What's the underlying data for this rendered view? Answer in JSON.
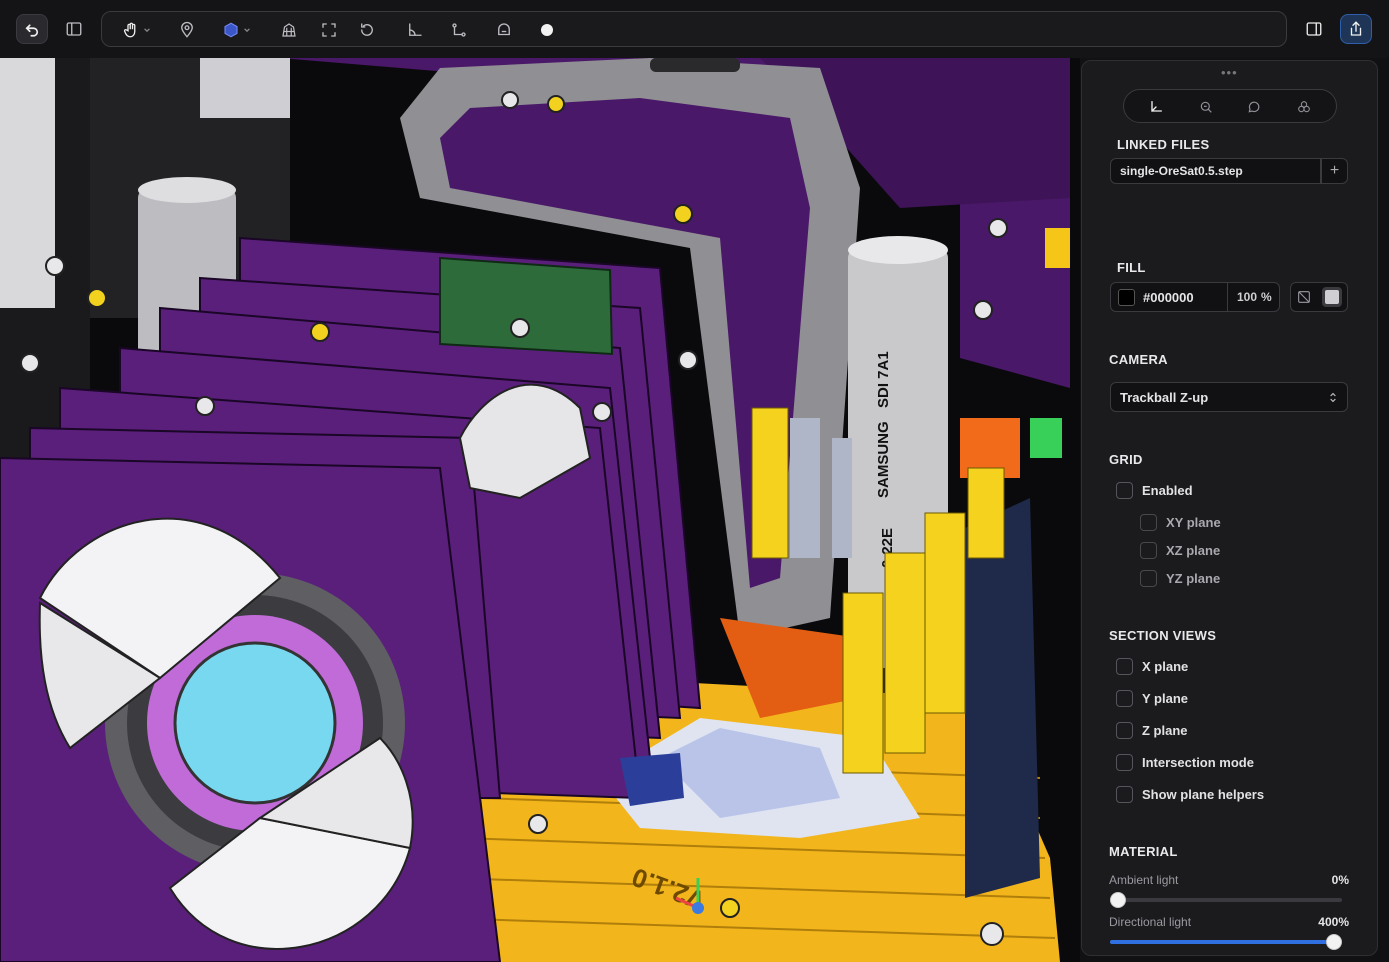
{
  "panel": {
    "linked_files": {
      "title": "LINKED FILES",
      "file": "single-OreSat0.5.step",
      "add_label": "+"
    },
    "fill": {
      "title": "FILL",
      "color_hex": "#000000",
      "opacity": "100",
      "opacity_unit": "%"
    },
    "camera": {
      "title": "CAMERA",
      "mode": "Trackball Z-up"
    },
    "grid": {
      "title": "GRID",
      "enabled_label": "Enabled",
      "planes": [
        "XY plane",
        "XZ plane",
        "YZ plane"
      ]
    },
    "section_views": {
      "title": "SECTION VIEWS",
      "items": [
        "X plane",
        "Y plane",
        "Z plane",
        "Intersection mode",
        "Show plane helpers"
      ]
    },
    "material": {
      "title": "MATERIAL",
      "ambient": {
        "label": "Ambient light",
        "value_text": "0%",
        "value": 0,
        "max": 400
      },
      "directional": {
        "label": "Directional light",
        "value_text": "400%",
        "value": 400,
        "max": 400
      }
    }
  },
  "viewport": {
    "model_text": [
      "SDI 7A1",
      "SAMSUNG",
      "0-22E",
      "V2.1.0"
    ]
  },
  "colors": {
    "accent": "#2f6fe0",
    "purple_board": "#5a1f7a",
    "gold": "#f2b51c",
    "lens": "#78d8f0"
  },
  "icons": [
    "undo-icon",
    "sidebar-icon",
    "hand-pan-icon",
    "pin-icon",
    "cube-icon",
    "building-icon",
    "fit-frame-icon",
    "rotate-icon",
    "measure-angle-icon",
    "measure-distance-icon",
    "helmet-icon",
    "circle-icon",
    "panel-right-icon",
    "share-icon"
  ]
}
